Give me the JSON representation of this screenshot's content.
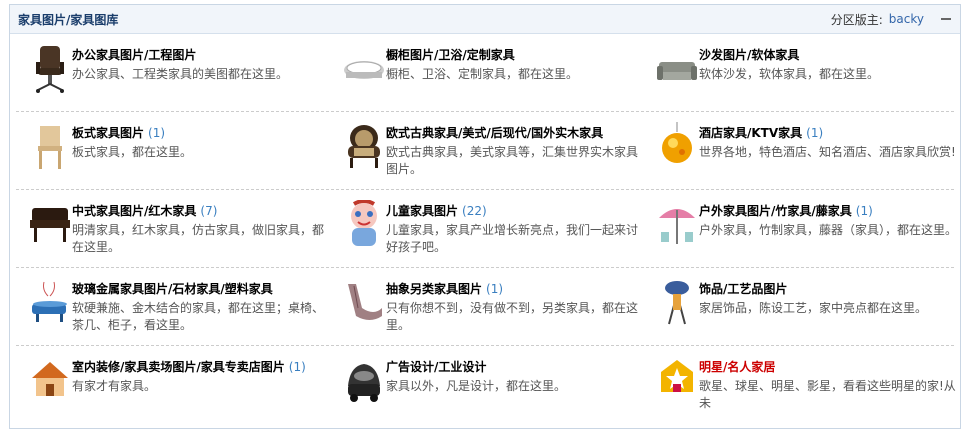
{
  "header": {
    "title": "家具图片/家具图库",
    "moderator_label": "分区版主:",
    "moderator_name": "backy"
  },
  "forums": [
    [
      {
        "name": "办公家具图片/工程图片",
        "count": "",
        "desc": "办公家具、工程类家具的美图都在这里。",
        "icon": "office-chair-icon"
      },
      {
        "name": "橱柜图片/卫浴/定制家具",
        "count": "",
        "desc": "橱柜、卫浴、定制家具，都在这里。",
        "icon": "bathtub-icon"
      },
      {
        "name": "沙发图片/软体家具",
        "count": "",
        "desc": "软体沙发，软体家具，都在这里。",
        "icon": "sofa-icon"
      }
    ],
    [
      {
        "name": "板式家具图片",
        "count": "(1)",
        "desc": "板式家具，都在这里。",
        "icon": "wooden-chair-icon"
      },
      {
        "name": "欧式古典家具/美式/后现代/国外实木家具",
        "count": "",
        "desc": "欧式古典家具，美式家具等，汇集世界实木家具图片。",
        "icon": "armchair-icon"
      },
      {
        "name": "酒店家具/KTV家具",
        "count": "(1)",
        "desc": "世界各地，特色酒店、知名酒店、酒店家具欣赏!",
        "icon": "disco-ball-icon"
      }
    ],
    [
      {
        "name": "中式家具图片/红木家具",
        "count": "(7)",
        "desc": "明清家具，红木家具，仿古家具，做旧家具，都在这里。",
        "icon": "chinese-bench-icon"
      },
      {
        "name": "儿童家具图片",
        "count": "(22)",
        "desc": "儿童家具，家具产业增长新亮点，我们一起来讨好孩子吧。",
        "icon": "baby-icon"
      },
      {
        "name": "户外家具图片/竹家具/藤家具",
        "count": "(1)",
        "desc": "户外家具，竹制家具，藤器（家具），都在这里。",
        "icon": "patio-umbrella-icon"
      }
    ],
    [
      {
        "name": "玻璃金属家具图片/石材家具/塑料家具",
        "count": "",
        "desc": "软硬兼施、金木结合的家具，都在这里；桌椅、茶几、柜子，看这里。",
        "icon": "glass-table-icon"
      },
      {
        "name": "抽象另类家具图片",
        "count": "(1)",
        "desc": "只有你想不到，没有做不到，另类家具，都在这里。",
        "icon": "abstract-chair-icon"
      },
      {
        "name": "饰品/工艺品图片",
        "count": "",
        "desc": "家居饰品，陈设工艺，家中亮点都在这里。",
        "icon": "lamp-icon"
      }
    ],
    [
      {
        "name": "室内装修/家具卖场图片/家具专卖店图片",
        "count": "(1)",
        "desc": "有家才有家具。",
        "icon": "house-icon"
      },
      {
        "name": "广告设计/工业设计",
        "count": "",
        "desc": "家具以外，凡是设计，都在这里。",
        "icon": "car-icon"
      },
      {
        "name": "明星/名人家居",
        "count": "",
        "desc": "歌星、球星、明星、影星，看看这些明星的家!从未",
        "icon": "star-home-icon"
      }
    ]
  ]
}
